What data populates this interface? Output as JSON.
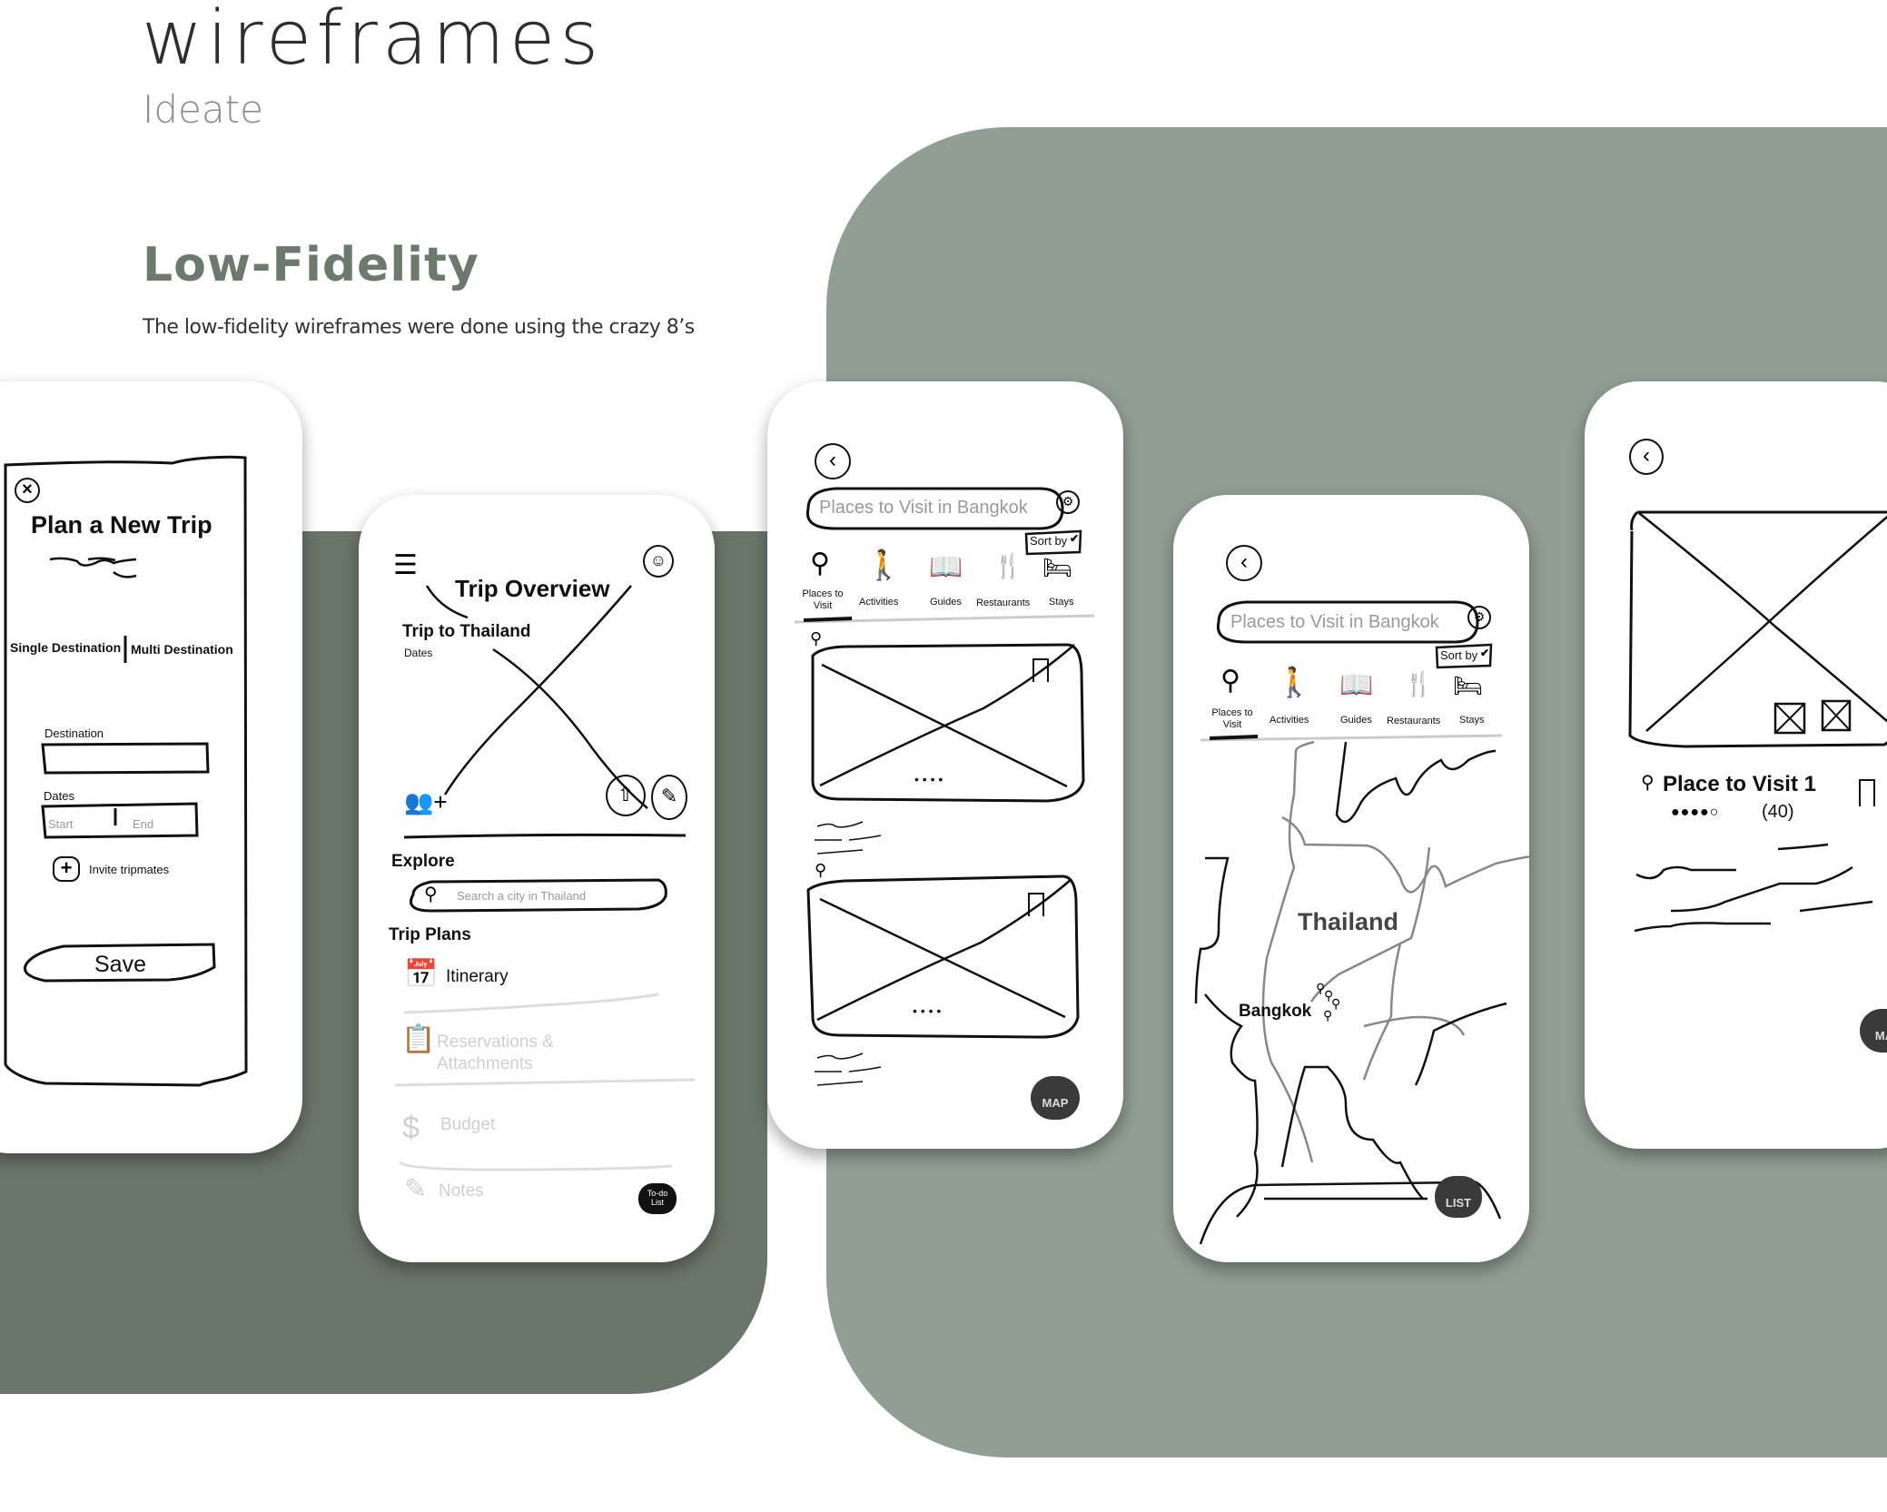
{
  "page": {
    "title": "wireframes",
    "subtitle": "Ideate",
    "section_title": "Low-Fidelity",
    "section_description": "The low-fidelity wireframes were done using the crazy 8’s"
  },
  "colors": {
    "dark_green": "#6b766b",
    "light_green": "#909e93",
    "section_title": "#6b7a6d"
  },
  "screens": {
    "plan_trip": {
      "heading": "Plan a New Trip",
      "tab_single": "Single Destination",
      "tab_multi": "Multi Destination",
      "destination_label": "Destination",
      "dates_label": "Dates",
      "start_placeholder": "Start",
      "end_placeholder": "End",
      "invite_label": "Invite tripmates",
      "save_label": "Save",
      "icons": [
        "close-icon",
        "add-icon"
      ]
    },
    "trip_overview": {
      "heading": "Trip Overview",
      "trip_name": "Trip to Thailand",
      "dates_label": "Dates",
      "explore_label": "Explore",
      "search_placeholder": "Search a city in Thailand",
      "trip_plans_label": "Trip Plans",
      "plans": [
        {
          "label": "Itinerary",
          "icon": "calendar-icon",
          "state": "active"
        },
        {
          "label": "Reservations & Attachments",
          "icon": "clipboard-icon",
          "state": "disabled"
        },
        {
          "label": "Budget",
          "icon": "dollar-icon",
          "state": "disabled"
        },
        {
          "label": "Notes",
          "icon": "note-icon",
          "state": "disabled"
        }
      ],
      "todo_badge_line1": "To-do",
      "todo_badge_line2": "List",
      "icons": [
        "menu-icon",
        "profile-icon",
        "tripmates-icon",
        "share-icon",
        "edit-icon"
      ]
    },
    "places_list": {
      "search_placeholder": "Places to Visit in Bangkok",
      "sort_label": "Sort by",
      "categories": [
        {
          "label": "Places to Visit",
          "icon": "map-pin-icon",
          "active": true
        },
        {
          "label": "Activities",
          "icon": "walking-icon",
          "active": false
        },
        {
          "label": "Guides",
          "icon": "book-icon",
          "active": false
        },
        {
          "label": "Restaurants",
          "icon": "utensils-icon",
          "active": false
        },
        {
          "label": "Stays",
          "icon": "bed-icon",
          "active": false
        }
      ],
      "card_dots": "• • • •",
      "map_button_label": "MAP"
    },
    "places_map": {
      "search_placeholder": "Places to Visit in Bangkok",
      "sort_label": "Sort by",
      "categories": [
        {
          "label": "Places to Visit",
          "icon": "map-pin-icon",
          "active": true
        },
        {
          "label": "Activities",
          "icon": "walking-icon",
          "active": false
        },
        {
          "label": "Guides",
          "icon": "book-icon",
          "active": false
        },
        {
          "label": "Restaurants",
          "icon": "utensils-icon",
          "active": false
        },
        {
          "label": "Stays",
          "icon": "bed-icon",
          "active": false
        }
      ],
      "country_label": "Thailand",
      "city_label": "Bangkok",
      "list_button_label": "LIST"
    },
    "place_detail": {
      "place_name": "Place to Visit 1",
      "rating_count": "(40)",
      "map_button_label": "MA"
    }
  }
}
